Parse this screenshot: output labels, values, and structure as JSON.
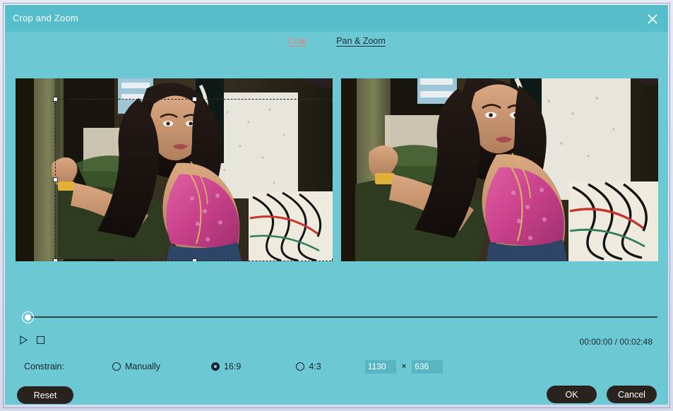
{
  "window": {
    "title": "Crop and Zoom",
    "close_icon": "close-icon"
  },
  "tabs": [
    {
      "label": "Crop",
      "active": true
    },
    {
      "label": "Pan & Zoom",
      "active": false
    }
  ],
  "previews": {
    "source_label": "source-preview",
    "result_label": "result-preview"
  },
  "crop_overlay": {
    "handles": 8
  },
  "transport": {
    "play_icon": "play-icon",
    "stop_icon": "stop-icon",
    "timecode": "00:00:00 / 00:02:48"
  },
  "constrain": {
    "label": "Constrain:",
    "options": [
      {
        "label": "Manually",
        "selected": false
      },
      {
        "label": "16:9",
        "selected": true
      },
      {
        "label": "4:3",
        "selected": false
      }
    ],
    "width_value": "1130",
    "height_value": "636",
    "separator": "×"
  },
  "buttons": {
    "reset": "Reset",
    "ok": "OK",
    "cancel": "Cancel"
  },
  "colors": {
    "dialog_bg": "#6cc9d4",
    "titlebar_bg": "#56bdca",
    "accent_active_tab": "#e8837f",
    "text_dark": "#16242e",
    "button_dark": "#2a221f",
    "input_bg": "#58b6c2"
  }
}
